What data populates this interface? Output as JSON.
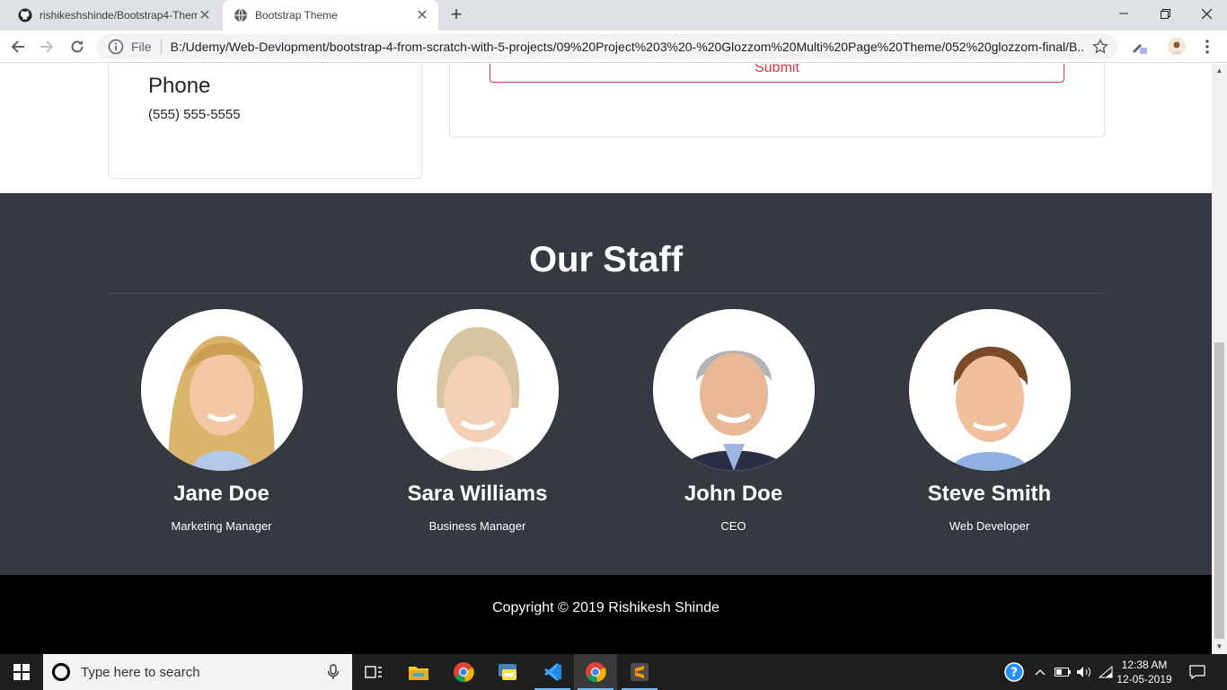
{
  "browser": {
    "tabs": [
      {
        "title": "rishikeshshinde/Bootstrap4-Them",
        "icon": "github-icon",
        "active": false
      },
      {
        "title": "Bootstrap Theme",
        "icon": "globe-icon",
        "active": true
      }
    ],
    "omnibox": {
      "scheme_label": "File",
      "url": "B:/Udemy/Web-Devlopment/bootstrap-4-from-scratch-with-5-projects/09%20Project%203%20-%20Glozzom%20Multi%20Page%20Theme/052%20glozzom-final/B..."
    }
  },
  "page": {
    "contact": {
      "heading": "Phone",
      "value": "(555) 555-5555"
    },
    "form": {
      "submit_label": "Submit"
    },
    "staff": {
      "title": "Our Staff",
      "members": [
        {
          "name": "Jane Doe",
          "role": "Marketing Manager"
        },
        {
          "name": "Sara Williams",
          "role": "Business Manager"
        },
        {
          "name": "John Doe",
          "role": "CEO"
        },
        {
          "name": "Steve Smith",
          "role": "Web Developer"
        }
      ]
    },
    "footer": {
      "copyright": "Copyright © 2019 Rishikesh Shinde"
    }
  },
  "taskbar": {
    "search_placeholder": "Type here to search",
    "apps": [
      "task-view-icon",
      "file-explorer-icon",
      "chrome-icon",
      "python-icon",
      "vscode-icon",
      "chrome-icon",
      "sublime-text-icon"
    ],
    "clock": {
      "time": "12:38 AM",
      "date": "12-05-2019"
    }
  },
  "colors": {
    "staff_bg": "#343a40",
    "footer_bg": "#000000",
    "submit_outline": "#dc3545",
    "taskbar_bg": "#1f1f1f"
  }
}
